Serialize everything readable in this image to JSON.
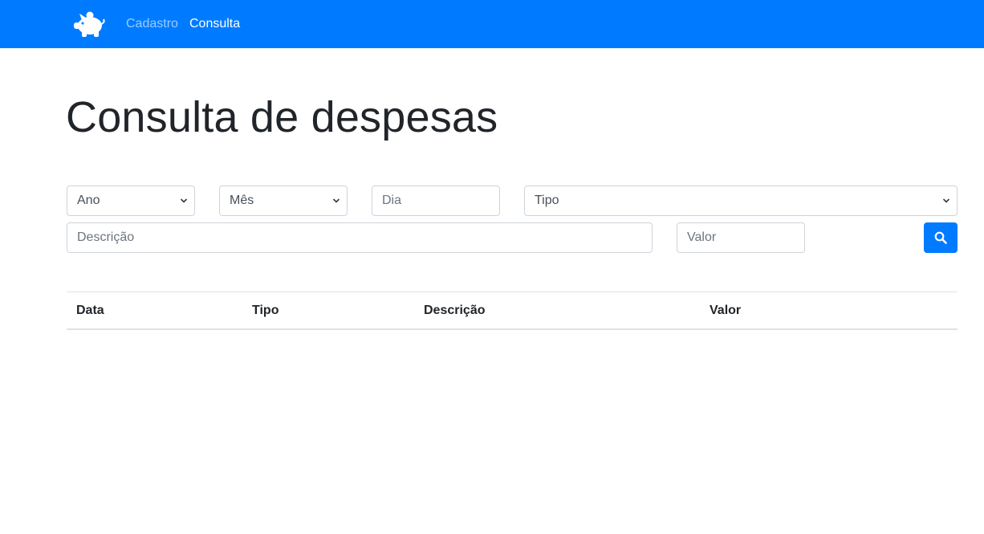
{
  "navbar": {
    "brand_icon": "piggy-bank-icon",
    "links": [
      {
        "label": "Cadastro",
        "active": false
      },
      {
        "label": "Consulta",
        "active": true
      }
    ],
    "background": "#007bff"
  },
  "page": {
    "title": "Consulta de despesas"
  },
  "filters": {
    "ano": {
      "value": "Ano"
    },
    "mes": {
      "value": "Mês"
    },
    "dia": {
      "placeholder": "Dia"
    },
    "tipo": {
      "value": "Tipo"
    },
    "descricao": {
      "placeholder": "Descrição"
    },
    "valor": {
      "placeholder": "Valor"
    },
    "search_icon": "search-icon"
  },
  "table": {
    "columns": [
      "Data",
      "Tipo",
      "Descrição",
      "Valor"
    ],
    "rows": []
  }
}
